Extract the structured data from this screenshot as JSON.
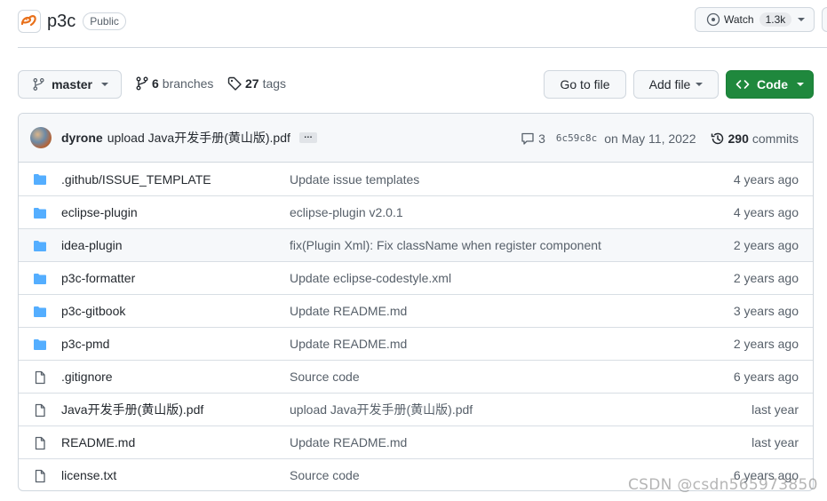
{
  "repo": {
    "name": "p3c",
    "visibility": "Public",
    "logo_icon": "alibaba-logo-icon"
  },
  "watch": {
    "label": "Watch",
    "count": "1.3k"
  },
  "toolbar": {
    "branch": "master",
    "branches_count": "6",
    "branches_label": "branches",
    "tags_count": "27",
    "tags_label": "tags",
    "goto_file": "Go to file",
    "add_file": "Add file",
    "code": "Code"
  },
  "commit": {
    "author": "dyrone",
    "message": "upload Java开发手册(黄山版).pdf",
    "ellipsis": "…",
    "comments": "3",
    "sha": "6c59c8c",
    "date": "on May 11, 2022",
    "commits_count": "290",
    "commits_label": "commits"
  },
  "files": [
    {
      "type": "folder",
      "name": ".github/ISSUE_TEMPLATE",
      "message": "Update issue templates",
      "age": "4 years ago"
    },
    {
      "type": "folder",
      "name": "eclipse-plugin",
      "message": "eclipse-plugin v2.0.1",
      "age": "4 years ago"
    },
    {
      "type": "folder",
      "name": "idea-plugin",
      "message": "fix(Plugin Xml): Fix className when register component",
      "age": "2 years ago"
    },
    {
      "type": "folder",
      "name": "p3c-formatter",
      "message": "Update eclipse-codestyle.xml",
      "age": "2 years ago"
    },
    {
      "type": "folder",
      "name": "p3c-gitbook",
      "message": "Update README.md",
      "age": "3 years ago"
    },
    {
      "type": "folder",
      "name": "p3c-pmd",
      "message": "Update README.md",
      "age": "2 years ago"
    },
    {
      "type": "file",
      "name": ".gitignore",
      "message": "Source code",
      "age": "6 years ago"
    },
    {
      "type": "file",
      "name": "Java开发手册(黄山版).pdf",
      "message": "upload Java开发手册(黄山版).pdf",
      "age": "last year"
    },
    {
      "type": "file",
      "name": "README.md",
      "message": "Update README.md",
      "age": "last year"
    },
    {
      "type": "file",
      "name": "license.txt",
      "message": "Source code",
      "age": "6 years ago"
    }
  ],
  "watermark": "CSDN @csdn565973850",
  "colors": {
    "primary_button": "#1f883d",
    "folder": "#54aeff",
    "border": "#d0d7de",
    "muted_text": "#57606a"
  }
}
